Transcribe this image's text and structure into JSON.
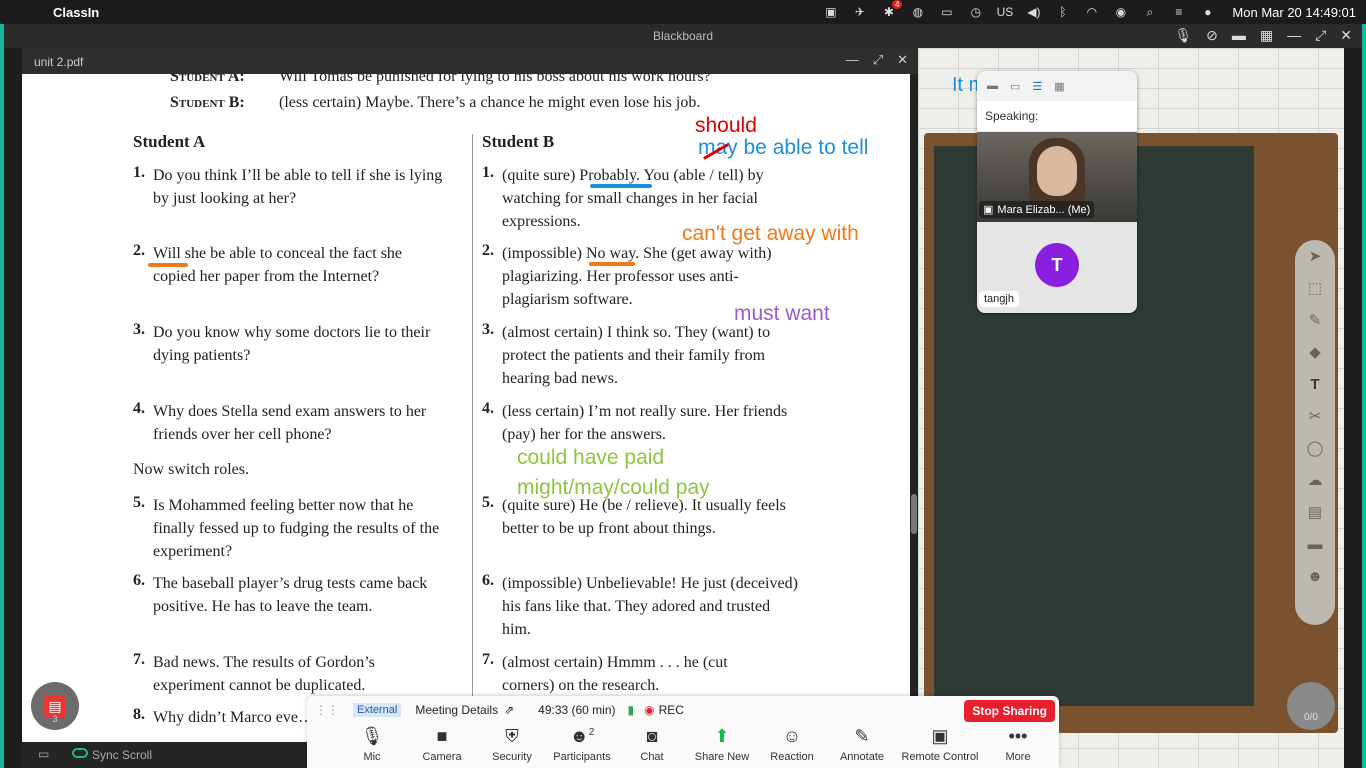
{
  "menubar": {
    "app": "ClassIn",
    "badge": "4",
    "clock": "Mon Mar 20  14:49:01"
  },
  "window": {
    "title": "Blackboard"
  },
  "pdf": {
    "filename": "unit 2.pdf",
    "sync": "Sync Scroll",
    "pdf_count": "3",
    "topA": "Student A:",
    "topA_text": "Will Tomas be punished for lying to his boss about his work hours?",
    "topB": "Student B:",
    "topB_text": "(less certain) Maybe. There’s a chance he might even lose his job.",
    "colA_header": "Student A",
    "colB_header": "Student B",
    "a1": "Do you think I’ll be able to tell if she is lying by just looking at her?",
    "a2": "Will she be able to conceal the fact she copied her paper from the Internet?",
    "a3": "Do you know why some doctors lie to their dying patients?",
    "a4": "Why does Stella send exam answers to her friends over her cell phone?",
    "switch": "Now switch roles.",
    "a5": "Is Mohammed feeling better now that he finally fessed up to fudging the results of the experiment?",
    "a6": "The baseball player’s drug tests came back positive. He has to leave the team.",
    "a7": "Bad news. The results of Gordon’s experiment cannot be duplicated.",
    "a8": "Why didn’t Marco eve… his name change?",
    "b1": "(quite sure) Probably. You (able / tell) by watching for small changes in her facial expressions.",
    "b2": "(impossible) No way. She (get away with) plagiarizing. Her professor uses anti-plagiarism software.",
    "b3": "(almost certain) I think so. They (want) to protect the patients and their family from hearing bad news.",
    "b4": "(less certain) I’m not really sure. Her friends (pay) her for the answers.",
    "b5": "(quite sure) He (be / relieve). It usually feels better to be up front about things.",
    "b6": "(impossible) Unbelievable! He just (deceived) his fans like that. They adored and trusted him.",
    "b7": "(almost certain) Hmmm . . . he (cut corners) on the research.",
    "n1": "1.",
    "n2": "2.",
    "n3": "3.",
    "n4": "4.",
    "n5": "5.",
    "n6": "6.",
    "n7": "7.",
    "n8": "8."
  },
  "annotations": {
    "should": "should",
    "may": "may be able to tell",
    "cant": "can't get away with",
    "must": "must want",
    "could": "could have paid",
    "might": "might/may/could pay"
  },
  "board": {
    "text": "It m                              ble to do it."
  },
  "zoom": {
    "speaking": "Speaking:",
    "me": "Mara Elizab... (Me)",
    "other_initial": "T",
    "other": "tangjh",
    "external": "External",
    "details": "Meeting Details",
    "timer": "49:33 (60 min)",
    "rec": "REC",
    "stop": "Stop Sharing",
    "buttons": [
      "Mic",
      "Camera",
      "Security",
      "Participants",
      "Chat",
      "Share New",
      "Reaction",
      "Annotate",
      "Remote Control",
      "More"
    ],
    "participants_count": "2"
  },
  "user_count": "0/0",
  "colors": {
    "accent": "#14b89a",
    "stop": "#e8202e",
    "red": "#e00000",
    "blue": "#1a8fe0",
    "orange": "#f07a1a",
    "purple": "#9a5ccc",
    "green": "#8cc63f"
  }
}
